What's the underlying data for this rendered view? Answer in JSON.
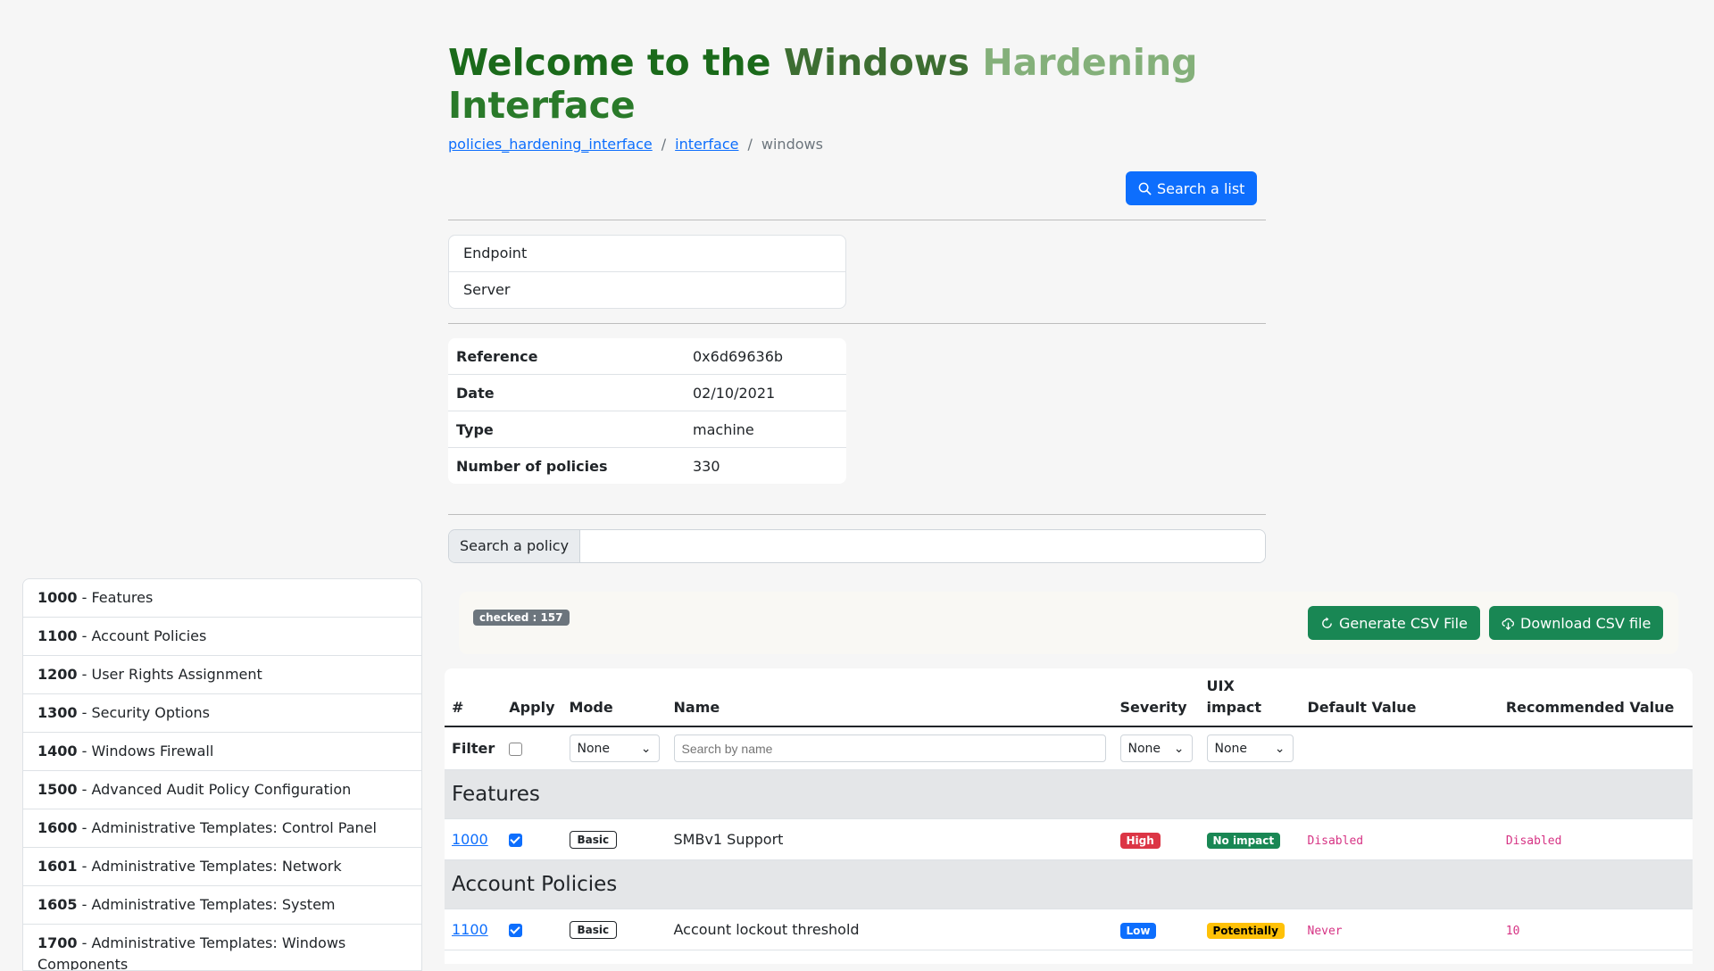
{
  "title": "Welcome to the Windows Hardening Interface",
  "breadcrumb": [
    "policies_hardening_interface",
    "interface",
    "windows"
  ],
  "search_list_button": "Search a list",
  "lists": [
    "Endpoint",
    "Server"
  ],
  "info": [
    {
      "key": "Reference",
      "value": "0x6d69636b"
    },
    {
      "key": "Date",
      "value": "02/10/2021"
    },
    {
      "key": "Type",
      "value": "machine"
    },
    {
      "key": "Number of policies",
      "value": "330"
    }
  ],
  "search_policy": {
    "label": "Search a policy",
    "value": ""
  },
  "sidebar": [
    {
      "id": "1000",
      "name": " - Features"
    },
    {
      "id": "1100",
      "name": " - Account Policies"
    },
    {
      "id": "1200",
      "name": " - User Rights Assignment"
    },
    {
      "id": "1300",
      "name": " - Security Options"
    },
    {
      "id": "1400",
      "name": " - Windows Firewall"
    },
    {
      "id": "1500",
      "name": " - Advanced Audit Policy Configuration"
    },
    {
      "id": "1600",
      "name": " - Administrative Templates: Control Panel"
    },
    {
      "id": "1601",
      "name": " - Administrative Templates: Network"
    },
    {
      "id": "1605",
      "name": " - Administrative Templates: System"
    },
    {
      "id": "1700",
      "name": " - Administrative Templates: Windows Components"
    }
  ],
  "toolbar": {
    "checked": "checked : 157",
    "generate": "Generate CSV File",
    "download": "Download CSV file"
  },
  "table": {
    "headers": {
      "num": "#",
      "apply": "Apply",
      "mode": "Mode",
      "name": "Name",
      "severity": "Severity",
      "uix": "UIX impact",
      "default": "Default Value",
      "recommended": "Recommended Value"
    },
    "filter": {
      "label": "Filter",
      "mode": "None",
      "name_placeholder": "Search by name",
      "severity": "None",
      "uix": "None"
    },
    "sections": [
      {
        "title": "Features",
        "rows": [
          {
            "id": "1000",
            "mode": "Basic",
            "name": "SMBv1 Support",
            "severity": "High",
            "uix": "No impact",
            "default": "Disabled",
            "recommended": "Disabled"
          }
        ]
      },
      {
        "title": "Account Policies",
        "rows": [
          {
            "id": "1100",
            "mode": "Basic",
            "name": "Account lockout threshold",
            "severity": "Low",
            "uix": "Potentially",
            "default": "Never",
            "recommended": "10"
          }
        ]
      }
    ]
  },
  "colors": {
    "primary": "#0d6efd",
    "success": "#198754",
    "danger": "#dc3545",
    "warning": "#ffc107",
    "secondary": "#6c757d"
  }
}
